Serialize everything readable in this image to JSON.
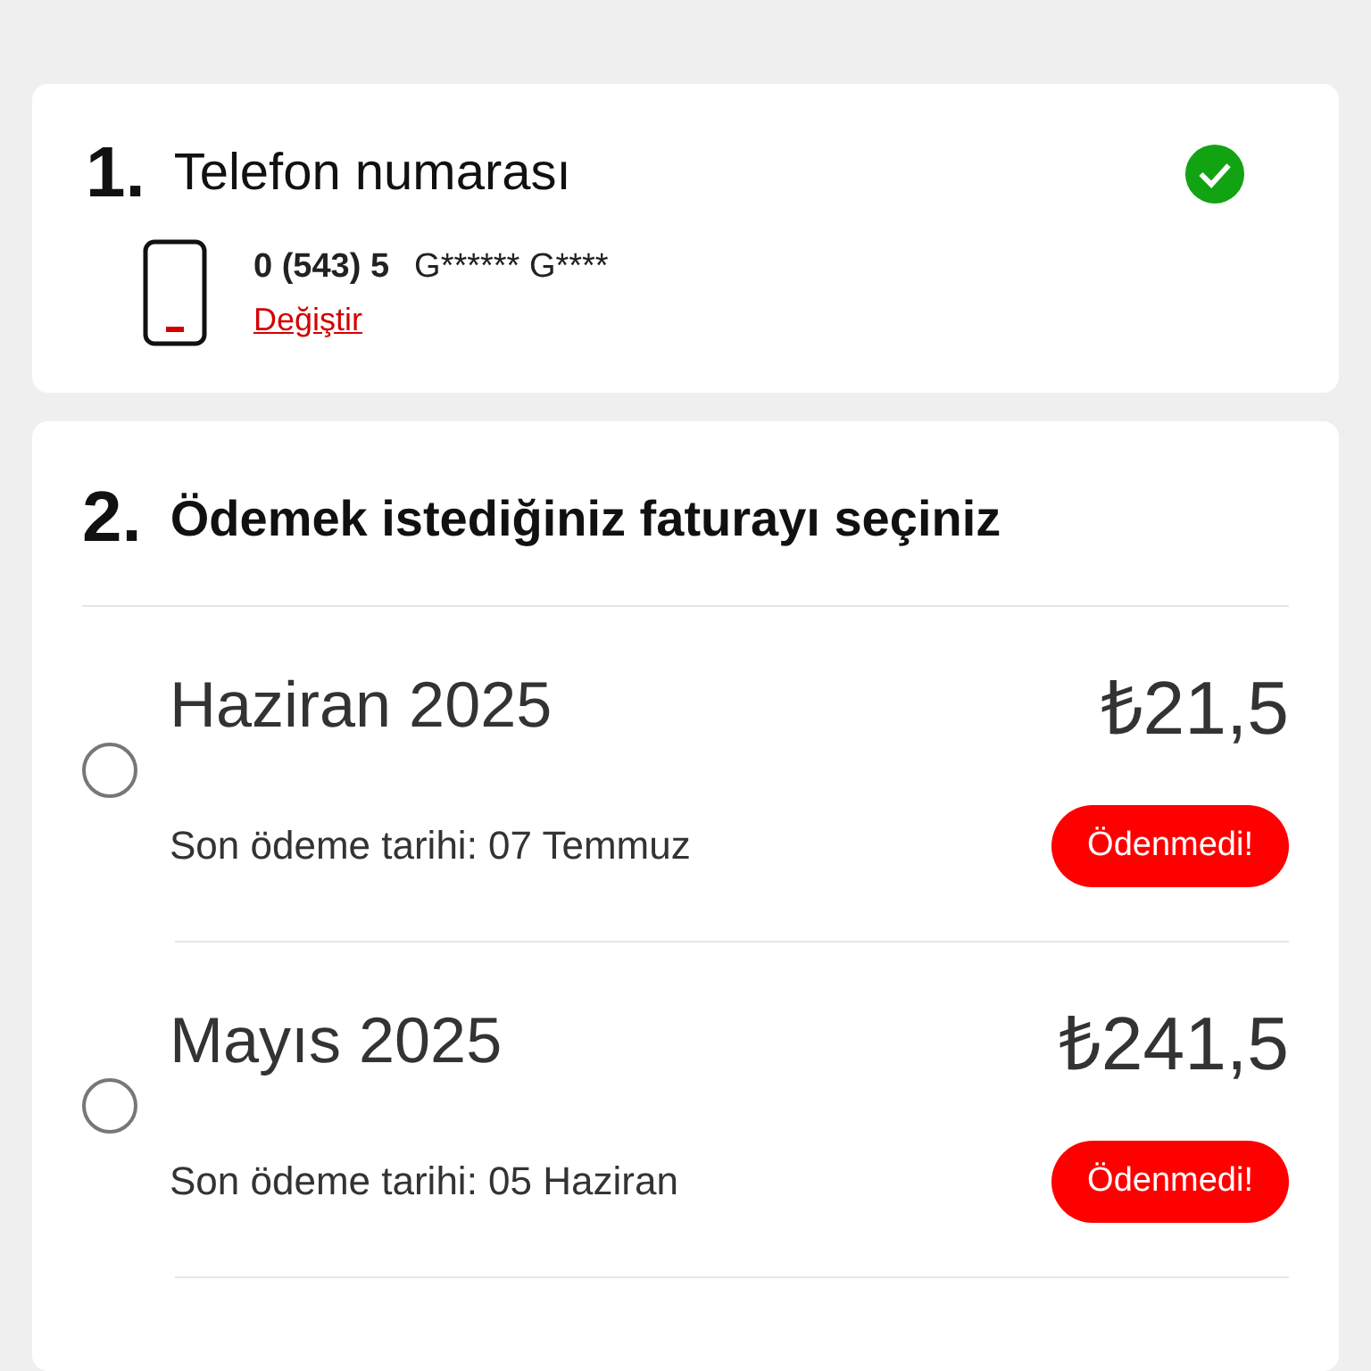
{
  "phone_section": {
    "step": "1.",
    "title": "Telefon numarası",
    "verified": true,
    "number": "0 (543) 5",
    "owner": "G****** G****",
    "change_link": "Değiştir"
  },
  "bill_section": {
    "step": "2.",
    "title": "Ödemek istediğiniz faturayı seçiniz",
    "bills": [
      {
        "period": "Haziran 2025",
        "amount": "₺21,5",
        "due": "Son ödeme tarihi: 07 Temmuz",
        "status": "Ödenmedi!",
        "selected": false
      },
      {
        "period": "Mayıs 2025",
        "amount": "₺241,5",
        "due": "Son ödeme tarihi: 05 Haziran",
        "status": "Ödenmedi!",
        "selected": false
      }
    ]
  }
}
